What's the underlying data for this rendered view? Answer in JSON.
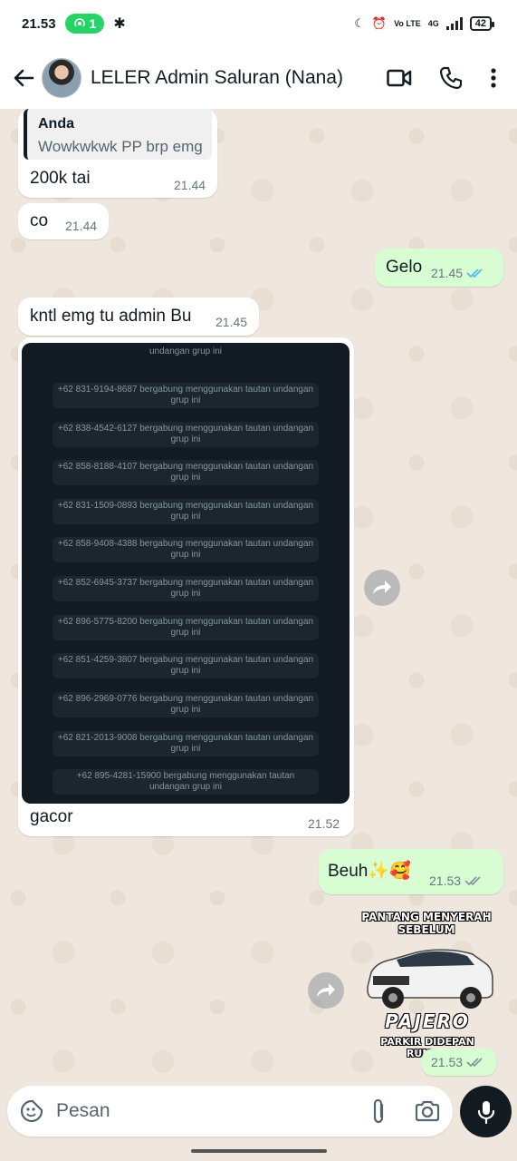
{
  "status_bar": {
    "time": "21.53",
    "hotspot_count": "1",
    "battery": "42",
    "volte_label": "Vo LTE",
    "network_label": "4G"
  },
  "header": {
    "title": "LELER Admin Saluran (Nana)",
    "icons": [
      "back-arrow-icon",
      "video-call-icon",
      "phone-icon",
      "more-vert-icon"
    ]
  },
  "messages": [
    {
      "direction": "in",
      "reply_to_name": "Anda",
      "reply_to_text": "Wowkwkwk PP brp emg",
      "text": "200k tai",
      "time": "21.44"
    },
    {
      "direction": "in",
      "text": "co",
      "time": "21.44"
    },
    {
      "direction": "out",
      "text": "Gelo",
      "time": "21.45",
      "status": "read"
    },
    {
      "direction": "in",
      "text": "kntl emg tu admin Bu",
      "time": "21.45"
    },
    {
      "direction": "in",
      "type": "image",
      "caption": "gacor",
      "time": "21.52",
      "image_lines": [
        "undangan grup ini",
        "+62 831-9194-8687 bergabung menggunakan tautan undangan grup ini",
        "+62 838-4542-6127 bergabung menggunakan tautan undangan grup ini",
        "+62 858-8188-4107 bergabung menggunakan tautan undangan grup ini",
        "+62 831-1509-0893 bergabung menggunakan tautan undangan grup ini",
        "+62 858-9408-4388 bergabung menggunakan tautan undangan grup ini",
        "+62 852-6945-3737 bergabung menggunakan tautan undangan grup ini",
        "+62 896-5775-8200 bergabung menggunakan tautan undangan grup ini",
        "+62 851-4259-3807 bergabung menggunakan tautan undangan grup ini",
        "+62 896-2969-0776 bergabung menggunakan tautan undangan grup ini",
        "+62 821-2013-9008 bergabung menggunakan tautan undangan grup ini",
        "+62 895-4281-15900 bergabung menggunakan tautan undangan grup ini"
      ]
    },
    {
      "direction": "out",
      "text": "Beuh✨🥰",
      "time": "21.53",
      "status": "delivered"
    },
    {
      "direction": "out",
      "type": "sticker",
      "sticker_text_top": "PANTANG MENYERAH SEBELUM",
      "sticker_brand": "PAJERO",
      "sticker_text_bottom": "PARKIR DIDEPAN RUMAH",
      "time": "21.53",
      "status": "delivered"
    }
  ],
  "input": {
    "placeholder": "Pesan",
    "icons": [
      "sticker-icon",
      "attach-icon",
      "camera-icon",
      "mic-icon"
    ]
  },
  "colors": {
    "incoming_bubble": "#ffffff",
    "outgoing_bubble": "#d9fdd3",
    "read_tick": "#53bdeb",
    "chat_bg": "#efe7dd",
    "hotspot_pill": "#25d366"
  }
}
